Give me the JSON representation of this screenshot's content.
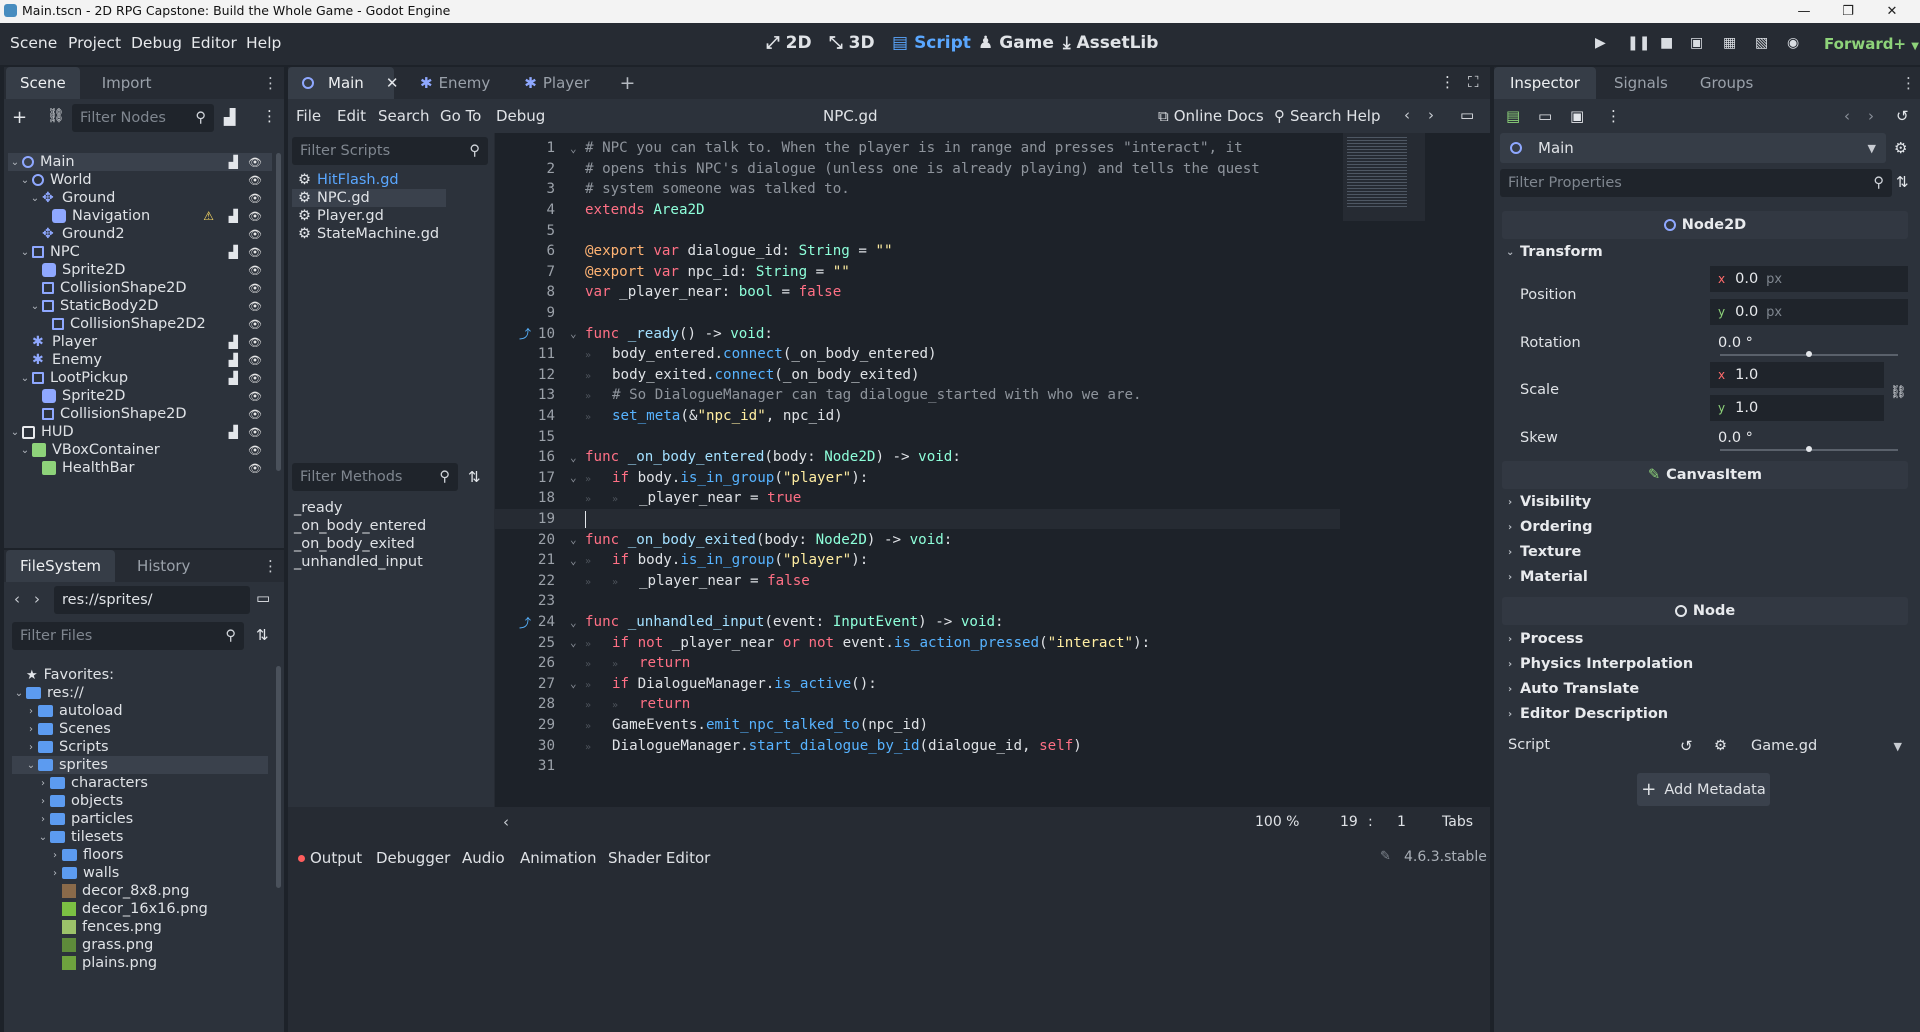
{
  "window": {
    "title": "Main.tscn - 2D RPG Capstone: Build the Whole Game - Godot Engine"
  },
  "menu": [
    "Scene",
    "Project",
    "Debug",
    "Editor",
    "Help"
  ],
  "modes": [
    {
      "label": "2D",
      "icon": "2d-mode-icon"
    },
    {
      "label": "3D",
      "icon": "3d-mode-icon"
    },
    {
      "label": "Script",
      "icon": "script-icon",
      "active": true
    },
    {
      "label": "Game",
      "icon": "game-icon"
    },
    {
      "label": "AssetLib",
      "icon": "assetlib-icon"
    }
  ],
  "renderer": "Forward+",
  "scene_dock": {
    "tabs": [
      "Scene",
      "Import"
    ],
    "filter_placeholder": "Filter Nodes",
    "nodes": [
      {
        "label": "Main",
        "depth": 0,
        "icon": "node2d-icon",
        "selected": true,
        "expanded": true
      },
      {
        "label": "World",
        "depth": 1,
        "icon": "node2d-icon",
        "expanded": true
      },
      {
        "label": "Ground",
        "depth": 2,
        "icon": "tilemap-icon",
        "expanded": true
      },
      {
        "label": "Navigation",
        "depth": 3,
        "icon": "navigation-icon",
        "warning": true
      },
      {
        "label": "Ground2",
        "depth": 2,
        "icon": "tilemap-icon"
      },
      {
        "label": "NPC",
        "depth": 1,
        "icon": "area2d-icon",
        "expanded": true
      },
      {
        "label": "Sprite2D",
        "depth": 2,
        "icon": "sprite-icon"
      },
      {
        "label": "CollisionShape2D",
        "depth": 2,
        "icon": "collision-icon"
      },
      {
        "label": "StaticBody2D",
        "depth": 2,
        "icon": "staticbody-icon",
        "expanded": true
      },
      {
        "label": "CollisionShape2D2",
        "depth": 3,
        "icon": "collision-icon"
      },
      {
        "label": "Player",
        "depth": 1,
        "icon": "character-icon"
      },
      {
        "label": "Enemy",
        "depth": 1,
        "icon": "character-icon"
      },
      {
        "label": "LootPickup",
        "depth": 1,
        "icon": "area2d-icon",
        "expanded": true
      },
      {
        "label": "Sprite2D",
        "depth": 2,
        "icon": "sprite-icon"
      },
      {
        "label": "CollisionShape2D",
        "depth": 2,
        "icon": "collision-icon"
      },
      {
        "label": "HUD",
        "depth": 0,
        "icon": "canvaslayer-icon",
        "expanded": true
      },
      {
        "label": "VBoxContainer",
        "depth": 1,
        "icon": "vbox-icon",
        "expanded": true
      },
      {
        "label": "HealthBar",
        "depth": 2,
        "icon": "progressbar-icon"
      }
    ]
  },
  "filesystem_dock": {
    "tabs": [
      "FileSystem",
      "History"
    ],
    "path": "res://sprites/",
    "filter_placeholder": "Filter Files",
    "items": [
      {
        "label": "Favorites:",
        "depth": 0,
        "icon": "star-icon"
      },
      {
        "label": "res://",
        "depth": 0,
        "icon": "folder-icon",
        "expanded": true
      },
      {
        "label": "autoload",
        "depth": 1,
        "icon": "folder-icon"
      },
      {
        "label": "Scenes",
        "depth": 1,
        "icon": "folder-icon"
      },
      {
        "label": "Scripts",
        "depth": 1,
        "icon": "folder-icon"
      },
      {
        "label": "sprites",
        "depth": 1,
        "icon": "folder-icon",
        "expanded": true,
        "selected": true
      },
      {
        "label": "characters",
        "depth": 2,
        "icon": "folder-icon"
      },
      {
        "label": "objects",
        "depth": 2,
        "icon": "folder-icon"
      },
      {
        "label": "particles",
        "depth": 2,
        "icon": "folder-icon"
      },
      {
        "label": "tilesets",
        "depth": 2,
        "icon": "folder-icon",
        "expanded": true
      },
      {
        "label": "floors",
        "depth": 3,
        "icon": "folder-icon"
      },
      {
        "label": "walls",
        "depth": 3,
        "icon": "folder-icon"
      },
      {
        "label": "decor_8x8.png",
        "depth": 3,
        "icon": "image-icon"
      },
      {
        "label": "decor_16x16.png",
        "depth": 3,
        "icon": "image-icon"
      },
      {
        "label": "fences.png",
        "depth": 3,
        "icon": "image-icon"
      },
      {
        "label": "grass.png",
        "depth": 3,
        "icon": "image-icon"
      },
      {
        "label": "plains.png",
        "depth": 3,
        "icon": "image-icon"
      }
    ]
  },
  "editor_tabs": [
    {
      "label": "Main",
      "active": true,
      "closable": true
    },
    {
      "label": "Enemy"
    },
    {
      "label": "Player"
    }
  ],
  "script_menu": [
    "File",
    "Edit",
    "Search",
    "Go To",
    "Debug"
  ],
  "script_title": "NPC.gd",
  "online_docs": "Online Docs",
  "search_help": "Search Help",
  "scripts_filter_placeholder": "Filter Scripts",
  "scripts": [
    {
      "label": "HitFlash.gd"
    },
    {
      "label": "NPC.gd",
      "selected": true
    },
    {
      "label": "Player.gd"
    },
    {
      "label": "StateMachine.gd"
    }
  ],
  "methods_filter_placeholder": "Filter Methods",
  "methods": [
    "_ready",
    "_on_body_entered",
    "_on_body_exited",
    "_unhandled_input"
  ],
  "code_lines": [
    {
      "n": "1",
      "fold": true,
      "tokens": [
        [
          "c",
          "# NPC you can talk to. When the player is in range and presses \"interact\", it"
        ]
      ]
    },
    {
      "n": "2",
      "tokens": [
        [
          "c",
          "# opens this NPC's dialogue (unless one is already playing) and tells the quest"
        ]
      ]
    },
    {
      "n": "3",
      "tokens": [
        [
          "c",
          "# system someone was talked to."
        ]
      ]
    },
    {
      "n": "4",
      "tokens": [
        [
          "k",
          "extends "
        ],
        [
          "t",
          "Area2D"
        ]
      ]
    },
    {
      "n": "5",
      "tokens": []
    },
    {
      "n": "6",
      "tokens": [
        [
          "a",
          "@export "
        ],
        [
          "k",
          "var "
        ],
        [
          "p",
          "dialogue_id: "
        ],
        [
          "t",
          "String"
        ],
        [
          "p",
          " = "
        ],
        [
          "s",
          "\"\""
        ]
      ]
    },
    {
      "n": "7",
      "tokens": [
        [
          "a",
          "@export "
        ],
        [
          "k",
          "var "
        ],
        [
          "p",
          "npc_id: "
        ],
        [
          "t",
          "String"
        ],
        [
          "p",
          " = "
        ],
        [
          "s",
          "\"\""
        ]
      ]
    },
    {
      "n": "8",
      "tokens": [
        [
          "k",
          "var "
        ],
        [
          "p",
          "_player_near: "
        ],
        [
          "t",
          "bool"
        ],
        [
          "p",
          " = "
        ],
        [
          "k",
          "false"
        ]
      ]
    },
    {
      "n": "9",
      "tokens": []
    },
    {
      "n": "10",
      "fold": true,
      "gutter": true,
      "tokens": [
        [
          "k",
          "func "
        ],
        [
          "b",
          "_ready"
        ],
        [
          "p",
          "() -> "
        ],
        [
          "t",
          "void"
        ],
        [
          "p",
          ":"
        ]
      ]
    },
    {
      "n": "11",
      "indent": 1,
      "tokens": [
        [
          "p",
          "body_entered."
        ],
        [
          "f",
          "connect"
        ],
        [
          "p",
          "(_on_body_entered)"
        ]
      ]
    },
    {
      "n": "12",
      "indent": 1,
      "tokens": [
        [
          "p",
          "body_exited."
        ],
        [
          "f",
          "connect"
        ],
        [
          "p",
          "(_on_body_exited)"
        ]
      ]
    },
    {
      "n": "13",
      "indent": 1,
      "tokens": [
        [
          "c",
          "# So DialogueManager can tag dialogue_started with who we are."
        ]
      ]
    },
    {
      "n": "14",
      "indent": 1,
      "tokens": [
        [
          "f",
          "set_meta"
        ],
        [
          "p",
          "(&"
        ],
        [
          "s",
          "\"npc_id\""
        ],
        [
          "p",
          ", npc_id)"
        ]
      ]
    },
    {
      "n": "15",
      "tokens": []
    },
    {
      "n": "16",
      "fold": true,
      "tokens": [
        [
          "k",
          "func "
        ],
        [
          "b",
          "_on_body_entered"
        ],
        [
          "p",
          "(body: "
        ],
        [
          "t",
          "Node2D"
        ],
        [
          "p",
          ") -> "
        ],
        [
          "t",
          "void"
        ],
        [
          "p",
          ":"
        ]
      ]
    },
    {
      "n": "17",
      "fold": true,
      "indent": 1,
      "tokens": [
        [
          "k",
          "if "
        ],
        [
          "p",
          "body."
        ],
        [
          "f",
          "is_in_group"
        ],
        [
          "p",
          "("
        ],
        [
          "s",
          "\"player\""
        ],
        [
          "p",
          "):"
        ]
      ]
    },
    {
      "n": "18",
      "indent": 2,
      "tokens": [
        [
          "p",
          "_player_near = "
        ],
        [
          "k",
          "true"
        ]
      ]
    },
    {
      "n": "19",
      "current": true,
      "tokens": []
    },
    {
      "n": "20",
      "fold": true,
      "tokens": [
        [
          "k",
          "func "
        ],
        [
          "b",
          "_on_body_exited"
        ],
        [
          "p",
          "(body: "
        ],
        [
          "t",
          "Node2D"
        ],
        [
          "p",
          ") -> "
        ],
        [
          "t",
          "void"
        ],
        [
          "p",
          ":"
        ]
      ]
    },
    {
      "n": "21",
      "fold": true,
      "indent": 1,
      "tokens": [
        [
          "k",
          "if "
        ],
        [
          "p",
          "body."
        ],
        [
          "f",
          "is_in_group"
        ],
        [
          "p",
          "("
        ],
        [
          "s",
          "\"player\""
        ],
        [
          "p",
          "):"
        ]
      ]
    },
    {
      "n": "22",
      "indent": 2,
      "tokens": [
        [
          "p",
          "_player_near = "
        ],
        [
          "k",
          "false"
        ]
      ]
    },
    {
      "n": "23",
      "tokens": []
    },
    {
      "n": "24",
      "fold": true,
      "gutter": true,
      "tokens": [
        [
          "k",
          "func "
        ],
        [
          "b",
          "_unhandled_input"
        ],
        [
          "p",
          "(event: "
        ],
        [
          "t",
          "InputEvent"
        ],
        [
          "p",
          ") -> "
        ],
        [
          "t",
          "void"
        ],
        [
          "p",
          ":"
        ]
      ]
    },
    {
      "n": "25",
      "fold": true,
      "indent": 1,
      "tokens": [
        [
          "k",
          "if not "
        ],
        [
          "p",
          "_player_near "
        ],
        [
          "k",
          "or not "
        ],
        [
          "p",
          "event."
        ],
        [
          "f",
          "is_action_pressed"
        ],
        [
          "p",
          "("
        ],
        [
          "s",
          "\"interact\""
        ],
        [
          "p",
          "):"
        ]
      ]
    },
    {
      "n": "26",
      "indent": 2,
      "tokens": [
        [
          "k",
          "return"
        ]
      ]
    },
    {
      "n": "27",
      "fold": true,
      "indent": 1,
      "tokens": [
        [
          "k",
          "if "
        ],
        [
          "p",
          "DialogueManager."
        ],
        [
          "f",
          "is_active"
        ],
        [
          "p",
          "():"
        ]
      ]
    },
    {
      "n": "28",
      "indent": 2,
      "tokens": [
        [
          "k",
          "return"
        ]
      ]
    },
    {
      "n": "29",
      "indent": 1,
      "tokens": [
        [
          "p",
          "GameEvents."
        ],
        [
          "f",
          "emit_npc_talked_to"
        ],
        [
          "p",
          "(npc_id)"
        ]
      ]
    },
    {
      "n": "30",
      "indent": 1,
      "tokens": [
        [
          "p",
          "DialogueManager."
        ],
        [
          "f",
          "start_dialogue_by_id"
        ],
        [
          "p",
          "(dialogue_id, "
        ],
        [
          "k",
          "self"
        ],
        [
          "p",
          ")"
        ]
      ]
    },
    {
      "n": "31",
      "tokens": []
    }
  ],
  "status": {
    "zoom": "100 %",
    "line": "19",
    "col": "1",
    "indent": "Tabs"
  },
  "bottom_tabs": [
    "Output",
    "Debugger",
    "Audio",
    "Animation",
    "Shader Editor"
  ],
  "version": "4.6.3.stable",
  "inspector": {
    "tabs": [
      "Inspector",
      "Signals",
      "Groups"
    ],
    "object": "Main",
    "filter_placeholder": "Filter Properties",
    "class_node2d": "Node2D",
    "transform": "Transform",
    "position_label": "Position",
    "position": {
      "x": "0.0",
      "y": "0.0",
      "unit": "px"
    },
    "rotation_label": "Rotation",
    "rotation": "0.0 °",
    "scale_label": "Scale",
    "scale": {
      "x": "1.0",
      "y": "1.0"
    },
    "skew_label": "Skew",
    "skew": "0.0 °",
    "class_canvasitem": "CanvasItem",
    "canvas_groups": [
      "Visibility",
      "Ordering",
      "Texture",
      "Material"
    ],
    "class_node": "Node",
    "node_groups": [
      "Process",
      "Physics Interpolation",
      "Auto Translate",
      "Editor Description"
    ],
    "script_label": "Script",
    "script_value": "Game.gd",
    "add_metadata": "Add Metadata"
  },
  "colors": {
    "accent": "#5aa7ff",
    "panel": "#262b33",
    "editor": "#1d2229"
  }
}
